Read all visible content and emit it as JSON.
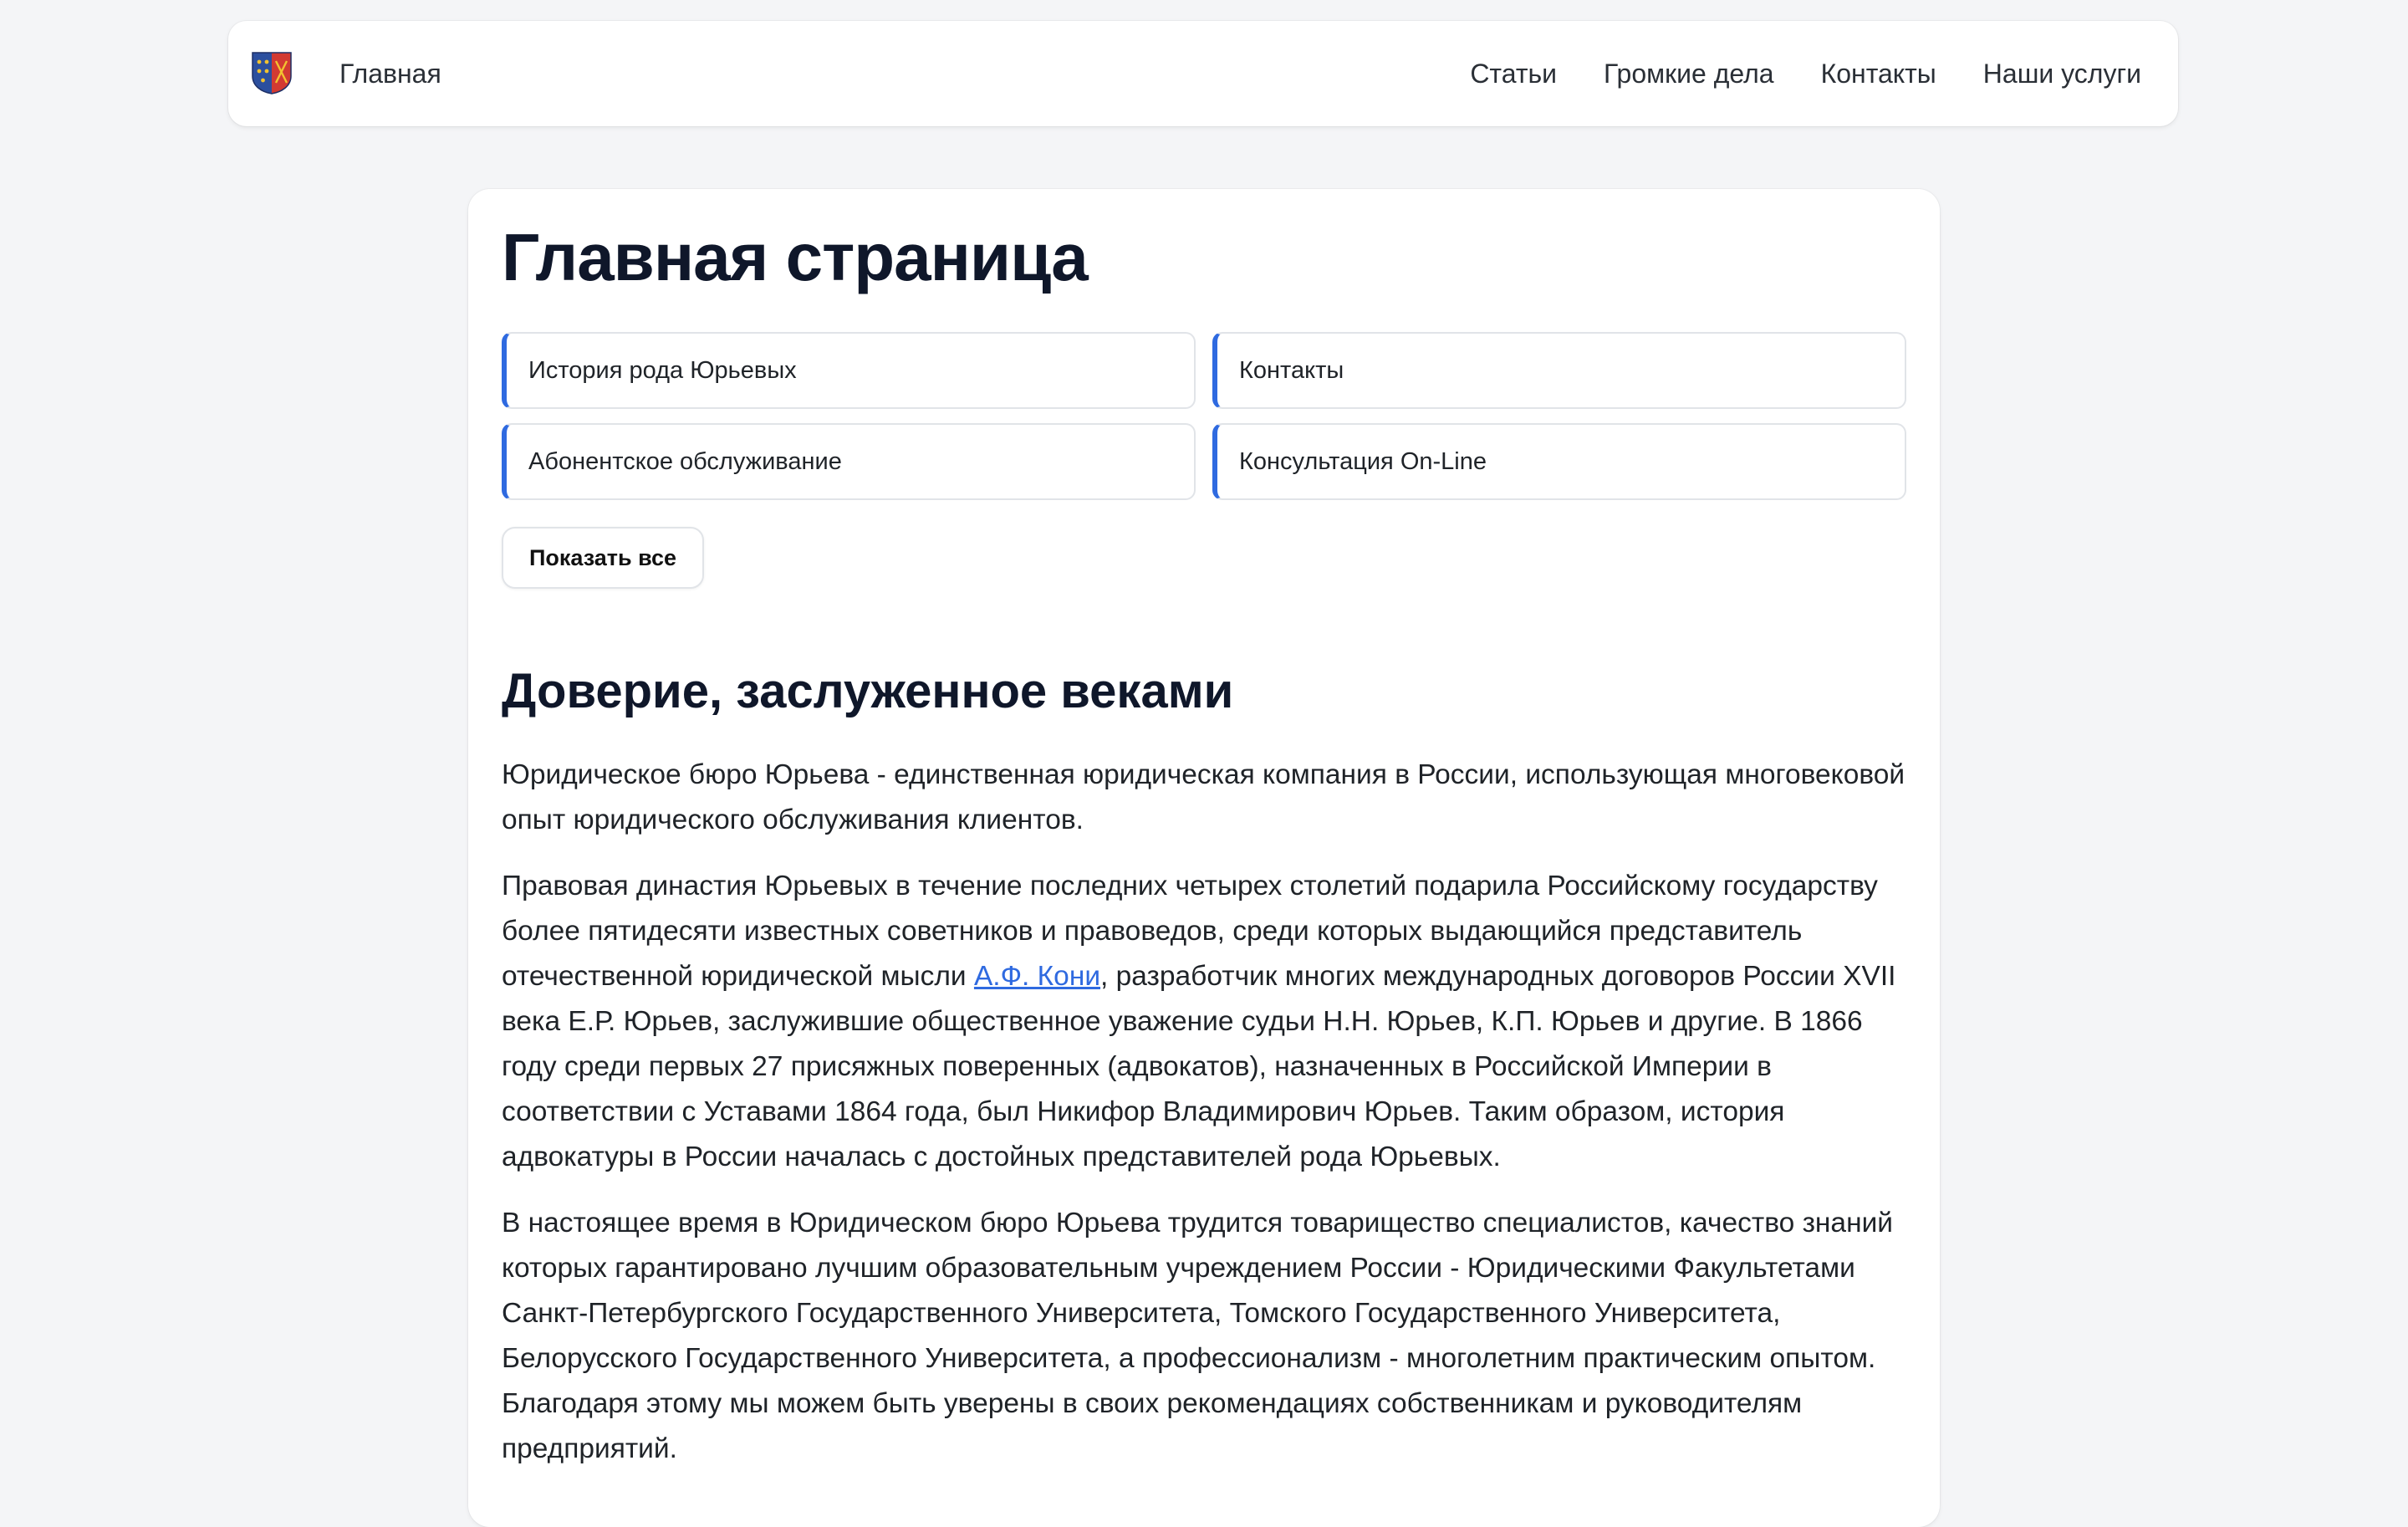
{
  "navbar": {
    "logo_icon": "coat-of-arms-icon",
    "brand": "Главная",
    "links": [
      "Статьи",
      "Громкие дела",
      "Контакты",
      "Наши услуги"
    ]
  },
  "main": {
    "title": "Главная страница",
    "tiles": [
      "История рода Юрьевых",
      "Контакты",
      "Абонентское обслуживание",
      "Консультация On-Line"
    ],
    "show_all": "Показать все",
    "section_heading": "Доверие, заслуженное веками",
    "p1": "Юридическое бюро Юрьева - единственная юридическая компания в России, использующая многовековой опыт юридического обслуживания клиентов.",
    "p2_before": "Правовая династия Юрьевых в течение последних четырех столетий подарила Российскому государству более пятидесяти известных советников и правоведов, среди которых выдающийся представитель отечественной юридической мысли ",
    "p2_link": "А.Ф. Кони",
    "p2_after": ", разработчик многих международных договоров России XVII века Е.Р. Юрьев, заслужившие общественное уважение судьи Н.Н. Юрьев, К.П. Юрьев и другие. В 1866 году среди первых 27 присяжных поверенных (адвокатов), назначенных в Российской Империи в соответствии с Уставами 1864 года, был Никифор Владимирович Юрьев. Таким образом, история адвокатуры в России началась с достойных представителей рода Юрьевых.",
    "p3": "В настоящее время в Юридическом бюро Юрьева трудится товарищество специалистов, качество знаний которых гарантировано лучшим образовательным учреждением России - Юридическими Факультетами Санкт-Петербургского Государственного Университета, Томского Государственного Университета, Белорусского Государственного Университета, а  профессионализм - многолетним практическим опытом. Благодаря этому мы можем быть уверены в  своих рекомендациях собственникам и руководителям предприятий."
  },
  "colors": {
    "accent": "#2f6ae0",
    "page_background": "#f4f5f7",
    "card_background": "#ffffff",
    "heading": "#0f172a"
  }
}
